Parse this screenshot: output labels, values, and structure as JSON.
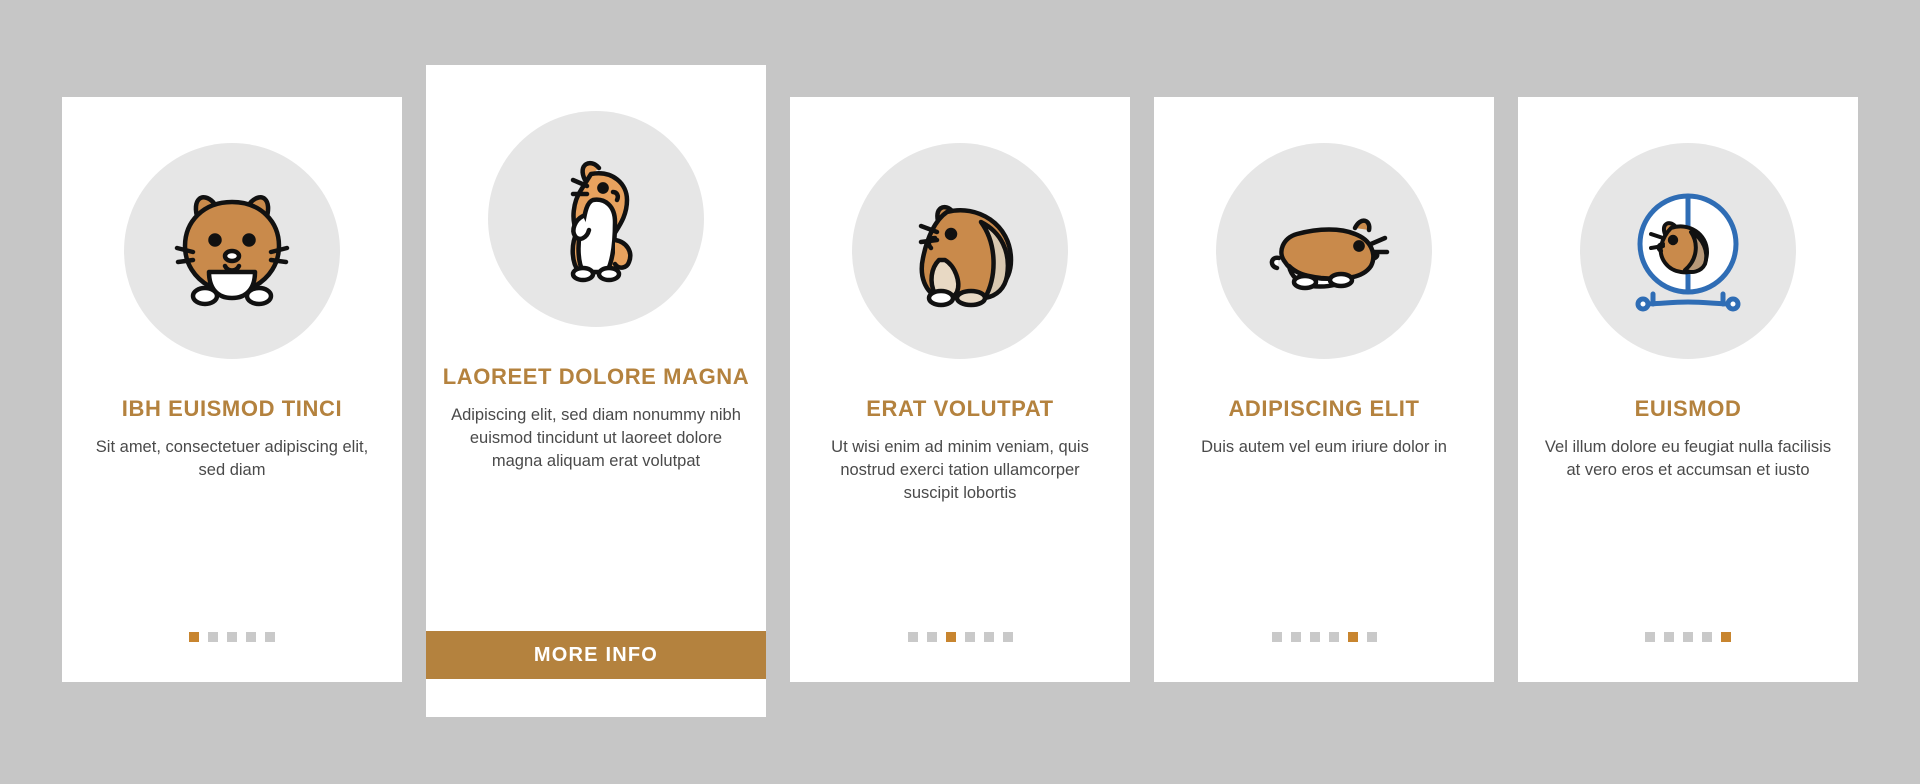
{
  "cards": [
    {
      "icon": "hamster-face-icon",
      "title": "IBH EUISMOD TINCI",
      "body": "Sit amet, consectetuer adipiscing elit, sed diam",
      "dots": {
        "count": 5,
        "active": 0
      },
      "featured": false
    },
    {
      "icon": "hamster-standing-icon",
      "title": "LAOREET DOLORE MAGNA",
      "body": "Adipiscing elit, sed diam nonummy nibh euismod tincidunt ut laoreet dolore magna aliquam erat volutpat",
      "button_label": "MORE INFO",
      "featured": true
    },
    {
      "icon": "hamster-sitting-icon",
      "title": "ERAT VOLUTPAT",
      "body": "Ut wisi enim ad minim veniam, quis nostrud exerci tation ullamcorper suscipit lobortis",
      "dots": {
        "count": 6,
        "active": 2
      },
      "featured": false
    },
    {
      "icon": "hamster-lying-icon",
      "title": "ADIPISCING ELIT",
      "body": "Duis autem vel eum iriure dolor in",
      "dots": {
        "count": 6,
        "active": 4
      },
      "featured": false
    },
    {
      "icon": "hamster-wheel-icon",
      "title": "EUISMOD",
      "body": "Vel illum dolore eu feugiat nulla facilisis at vero eros et accumsan et iusto",
      "dots": {
        "count": 5,
        "active": 4
      },
      "featured": false
    }
  ],
  "colors": {
    "background": "#c6c6c6",
    "card": "#ffffff",
    "accent": "#b4823e",
    "dot_active": "#c8852f",
    "dot_inactive": "#c9c9c9",
    "icon_circle": "#e6e6e6",
    "icon_fur": "#c98a4b",
    "icon_fur_light": "#e8a25e",
    "icon_outline": "#111111",
    "icon_blue": "#2f6db5"
  }
}
